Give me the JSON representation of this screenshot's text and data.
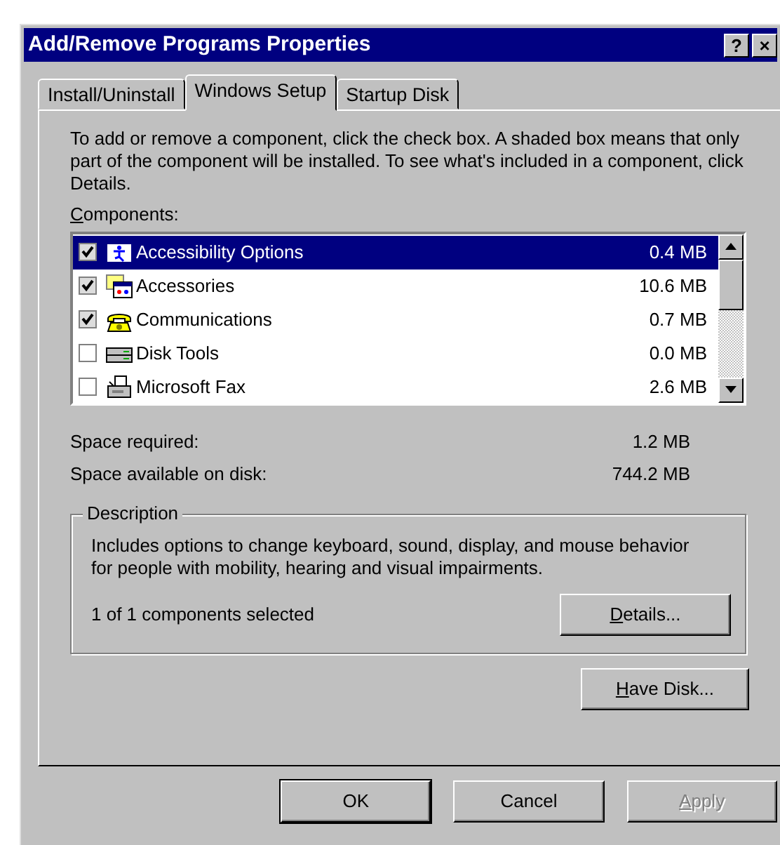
{
  "window": {
    "title": "Add/Remove Programs Properties",
    "title_buttons": [
      "?",
      "×"
    ]
  },
  "tabs": [
    {
      "label": "Install/Uninstall",
      "selected": false
    },
    {
      "label": "Windows Setup",
      "selected": true
    },
    {
      "label": "Startup Disk",
      "selected": false
    }
  ],
  "intro": "To add or remove a component, click the check box. A shaded box means that only part of the component will be installed. To see what's included in a component, click Details.",
  "components": {
    "label": "Components:",
    "access_key_underlined": true,
    "items": [
      {
        "name": "Accessibility Options",
        "size": "0.4 MB",
        "checked": true,
        "selected": true
      },
      {
        "name": "Accessories",
        "size": "10.6 MB",
        "checked": true,
        "selected": false
      },
      {
        "name": "Communications",
        "size": "0.7 MB",
        "checked": true,
        "selected": false
      },
      {
        "name": "Disk Tools",
        "size": "0.0 MB",
        "checked": false,
        "selected": false
      },
      {
        "name": "Microsoft Fax",
        "size": "2.6 MB",
        "checked": false,
        "selected": false
      }
    ]
  },
  "space": [
    {
      "label": "Space required:",
      "value": "1.2 MB"
    },
    {
      "label": "Space available on disk:",
      "value": "744.2 MB"
    }
  ],
  "description": {
    "legend": "Description",
    "text": "Includes options to change keyboard, sound, display, and mouse behavior for people with mobility, hearing and visual impairments.",
    "status": "1 of 1 components selected",
    "button": {
      "label": "Details...",
      "access_key_underlined": true
    }
  },
  "have_disk": {
    "label": "Have Disk...",
    "access_key_underlined": true
  },
  "buttons": [
    {
      "label": "OK",
      "disabled": false,
      "default": true
    },
    {
      "label": "Cancel",
      "disabled": false,
      "default": false
    },
    {
      "label": "Apply",
      "access_key_underlined": true,
      "disabled": true,
      "default": false
    }
  ]
}
